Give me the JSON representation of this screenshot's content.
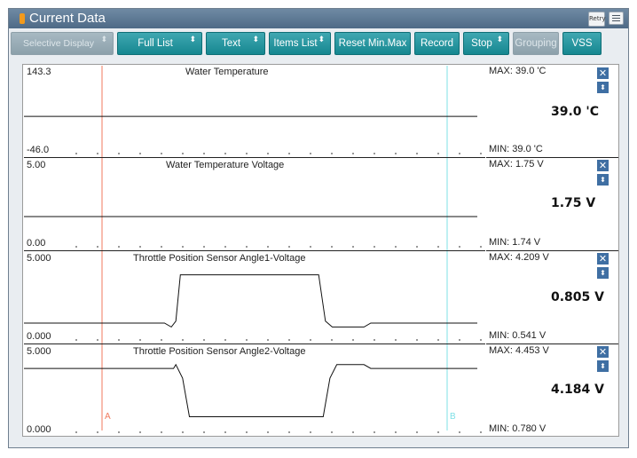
{
  "window": {
    "title": "Current Data",
    "retry_label": "Retry"
  },
  "toolbar": {
    "buttons": [
      {
        "label": "Selective Display",
        "dropdown": true,
        "enabled": false
      },
      {
        "label": "Full List",
        "dropdown": true,
        "enabled": true
      },
      {
        "label": "Text",
        "dropdown": true,
        "enabled": true
      },
      {
        "label": "Items List",
        "dropdown": true,
        "enabled": true
      },
      {
        "label": "Reset Min.Max",
        "dropdown": false,
        "enabled": true
      },
      {
        "label": "Record",
        "dropdown": false,
        "enabled": true
      },
      {
        "label": "Stop",
        "dropdown": true,
        "enabled": true
      },
      {
        "label": "Grouping",
        "dropdown": false,
        "enabled": false
      },
      {
        "label": "VSS",
        "dropdown": false,
        "enabled": true
      }
    ]
  },
  "cursors": {
    "a_label": "A",
    "b_label": "B",
    "a_color": "#f07a5e",
    "b_color": "#7fe0e6"
  },
  "graphs": [
    {
      "name": "Water Temperature",
      "scale_max": "143.3",
      "scale_min": "-46.0",
      "max_text": "MAX:  39.0 'C",
      "min_text": "MIN:  39.0 'C",
      "current": "39.0 'C",
      "trace": [
        [
          0,
          39.0
        ],
        [
          100,
          39.0
        ]
      ]
    },
    {
      "name": "Water Temperature Voltage",
      "scale_max": "5.00",
      "scale_min": "0.00",
      "max_text": "MAX:  1.75 V",
      "min_text": "MIN:  1.74 V",
      "current": "1.75 V",
      "trace": [
        [
          0,
          1.75
        ],
        [
          100,
          1.75
        ]
      ]
    },
    {
      "name": "Throttle Position Sensor Angle1-Voltage",
      "scale_max": "5.000",
      "scale_min": "0.000",
      "max_text": "MAX: 4.209 V",
      "min_text": "MIN: 0.541 V",
      "current": "0.805 V",
      "trace": [
        [
          0,
          0.81
        ],
        [
          31,
          0.81
        ],
        [
          32.5,
          0.54
        ],
        [
          33.5,
          0.95
        ],
        [
          34.5,
          4.21
        ],
        [
          65,
          4.21
        ],
        [
          66.5,
          0.95
        ],
        [
          68,
          0.54
        ],
        [
          75,
          0.54
        ],
        [
          76.5,
          0.81
        ],
        [
          100,
          0.81
        ]
      ]
    },
    {
      "name": "Throttle Position Sensor Angle2-Voltage",
      "scale_max": "5.000",
      "scale_min": "0.000",
      "max_text": "MAX: 4.453 V",
      "min_text": "MIN: 0.780 V",
      "current": "4.184 V",
      "trace": [
        [
          0,
          4.18
        ],
        [
          33,
          4.18
        ],
        [
          33.5,
          4.45
        ],
        [
          35,
          3.5
        ],
        [
          36.5,
          0.78
        ],
        [
          66,
          0.78
        ],
        [
          67.5,
          3.5
        ],
        [
          69,
          4.45
        ],
        [
          75,
          4.45
        ],
        [
          76.5,
          4.18
        ],
        [
          100,
          4.18
        ]
      ]
    }
  ]
}
